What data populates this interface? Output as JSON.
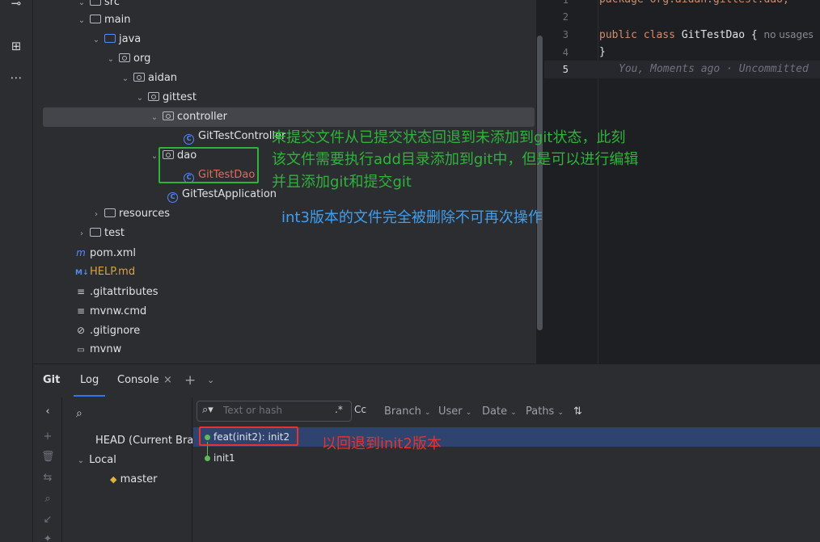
{
  "tree": {
    "items": [
      {
        "label": "src"
      },
      {
        "label": "main"
      },
      {
        "label": "java"
      },
      {
        "label": "org"
      },
      {
        "label": "aidan"
      },
      {
        "label": "gittest"
      },
      {
        "label": "controller"
      },
      {
        "label": "GitTestController"
      },
      {
        "label": "dao"
      },
      {
        "label": "GitTestDao"
      },
      {
        "label": "GitTestApplication"
      },
      {
        "label": "resources"
      },
      {
        "label": "test"
      },
      {
        "label": "pom.xml"
      },
      {
        "label": "HELP.md"
      },
      {
        "label": ".gitattributes"
      },
      {
        "label": "mvnw.cmd"
      },
      {
        "label": ".gitignore"
      },
      {
        "label": "mvnw"
      }
    ]
  },
  "editor": {
    "lines": [
      {
        "num": "1",
        "text": "package org.aidan.gittest.dao;"
      },
      {
        "num": "2",
        "text": ""
      },
      {
        "num": "3",
        "kw": "public class",
        "name": "GitTestDao {",
        "hint": "no usages"
      },
      {
        "num": "4",
        "text": "}"
      },
      {
        "num": "5",
        "blame": "You, Moments ago · Uncommitted"
      }
    ]
  },
  "annotations": {
    "green_line1": "未提交文件从已提交状态回退到未添加到git状态，此刻",
    "green_line2": "该文件需要执行add目录添加到git中，但是可以进行编辑",
    "green_line3": "并且添加git和提交git",
    "blue": "int3版本的文件完全被删除不可再次操作",
    "red": "以回退到init2版本"
  },
  "bottom": {
    "tabs": {
      "git": "Git",
      "log": "Log",
      "console": "Console"
    },
    "branches": {
      "head": "HEAD (Current Branch)",
      "local": "Local",
      "master": "master"
    },
    "log": {
      "search_placeholder": "Text or hash",
      "regex": ".*",
      "case": "Cc",
      "filters": [
        "Branch",
        "User",
        "Date",
        "Paths"
      ],
      "commits": [
        {
          "message": "feat(init2): init2"
        },
        {
          "message": "init1"
        }
      ]
    }
  },
  "colors": {
    "accent": "#3574f0",
    "annotation_green": "#2fb33a",
    "annotation_blue": "#3d9ff4",
    "annotation_red": "#e8332c"
  }
}
